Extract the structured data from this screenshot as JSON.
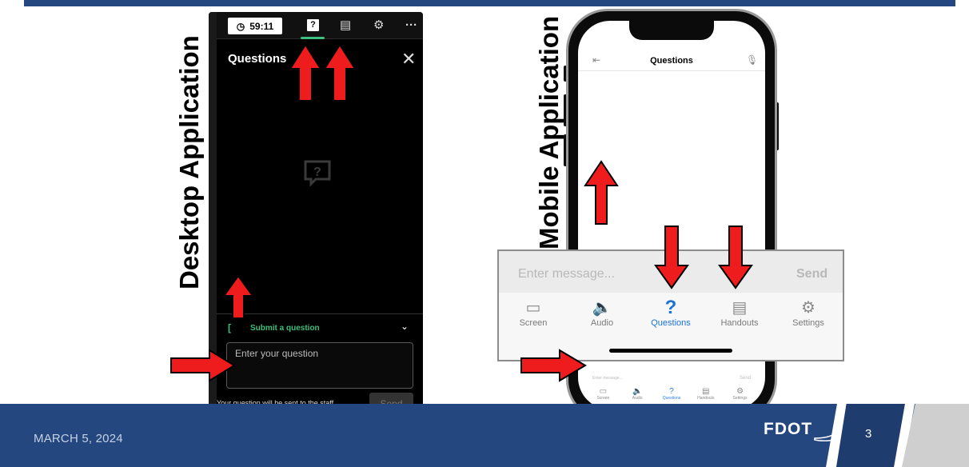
{
  "footer": {
    "date": "MARCH 5, 2024",
    "logo": "FDOT",
    "page": "3"
  },
  "labels": {
    "desktop": "Desktop Application",
    "mobile": "Mobile Application"
  },
  "desktop_app": {
    "timer": "59:11",
    "toolbar_q": "?",
    "title": "Questions",
    "submit_label": "Submit a question",
    "input_placeholder": "Enter your question",
    "note": "Your question will be sent to the staff",
    "send": "Send"
  },
  "mobile_app": {
    "title": "Questions",
    "message_placeholder": "Enter message...",
    "send": "Send",
    "tabs": [
      {
        "label": "Screen",
        "icon": "monitor-icon"
      },
      {
        "label": "Audio",
        "icon": "speaker-icon"
      },
      {
        "label": "Questions",
        "icon": "question-icon"
      },
      {
        "label": "Handouts",
        "icon": "handout-icon"
      },
      {
        "label": "Settings",
        "icon": "gear-icon"
      }
    ]
  },
  "colors": {
    "brand_blue": "#24477f",
    "accent_green": "#3fbf7f",
    "active_tab_blue": "#1a73d9",
    "arrow_red": "#ee1c1c"
  }
}
